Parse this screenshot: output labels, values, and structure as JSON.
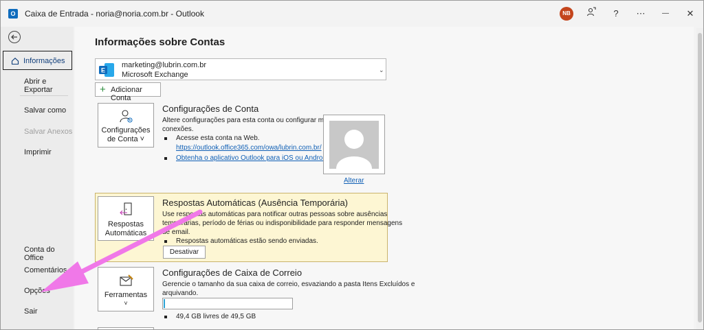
{
  "titlebar": {
    "title": "Caixa de Entrada - noria@noria.com.br  -  Outlook",
    "avatar_initials": "NB",
    "help_label": "?",
    "more_label": "⋯",
    "minimize_label": "—",
    "maximize_label": "☐",
    "close_label": "✕"
  },
  "sidebar": {
    "items": [
      {
        "label": "Informações"
      },
      {
        "label": "Abrir e Exportar"
      },
      {
        "label": "Salvar como"
      },
      {
        "label": "Salvar Anexos"
      },
      {
        "label": "Imprimir"
      },
      {
        "label": "Conta do Office"
      },
      {
        "label": "Comentários"
      },
      {
        "label": "Opções"
      },
      {
        "label": "Sair"
      }
    ]
  },
  "main": {
    "title": "Informações sobre Contas",
    "account": {
      "email": "marketing@lubrin.com.br",
      "type": "Microsoft Exchange"
    },
    "add_account_label": "Adicionar Conta",
    "account_settings": {
      "tile_line1": "Configurações",
      "tile_line2": "de Conta ˅",
      "title": "Configurações de Conta",
      "text_line1": "Altere configurações para esta conta ou configurar mais",
      "text_line2": "conexões.",
      "bullet1": "Acesse esta conta na Web.",
      "link1": "https://outlook.office365.com/owa/lubrin.com.br/",
      "link2": "Obtenha o aplicativo Outlook para iOS ou Android.",
      "change_photo": "Alterar"
    },
    "auto_replies": {
      "tile_line1": "Respostas",
      "tile_line2": "Automáticas",
      "title": "Respostas Automáticas (Ausência Temporária)",
      "text_line1": "Use respostas automáticas para notificar outras pessoas sobre ausências",
      "text_line2": "temporárias, período de férias ou indisponibilidade para responder mensagens",
      "text_line3": "de email.",
      "bullet": "Respostas automáticas estão sendo enviadas.",
      "button_label": "Desativar"
    },
    "mailbox": {
      "tile_line1": "Ferramentas",
      "tile_line2": "˅",
      "title": "Configurações de Caixa de Correio",
      "text_line1": "Gerencie o tamanho da sua caixa de correio, esvaziando a pasta Itens Excluídos e",
      "text_line2": "arquivando.",
      "usage_fraction": 0.01,
      "usage_text": "49,4 GB livres de 49,5 GB"
    }
  },
  "colors": {
    "accent": "#0f6cbd",
    "avatar": "#c4451c",
    "highlight_panel": "#fdf6d3",
    "annotation_arrow": "#f078e8",
    "progress": "#2ba3d6"
  }
}
